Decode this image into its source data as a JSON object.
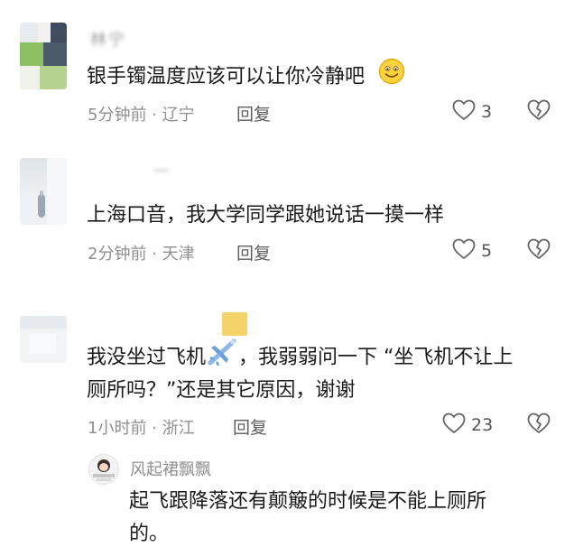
{
  "comments": [
    {
      "username": "林宁",
      "text": "银手镯温度应该可以让你冷静吧",
      "time": "5分钟前",
      "location": "辽宁",
      "reply_label": "回复",
      "likes": "3"
    },
    {
      "username": "—",
      "text": "上海口音，我大学同学跟她说话一摸一样",
      "time": "2分钟前",
      "location": "天津",
      "reply_label": "回复",
      "likes": "5"
    },
    {
      "username": "",
      "text_line1_a": "我没坐过飞机",
      "text_line1_b": "，我弱弱问一下 “坐飞机不让上",
      "text_line2": "厕所吗？”还是其它原因，谢谢",
      "time": "1小时前",
      "location": "浙江",
      "reply_label": "回复",
      "likes": "23"
    }
  ],
  "reply": {
    "username": "风起裙飘飘",
    "text_line1": "起飞跟降落还有颠簸的时候是不能上厕所",
    "text_line2": "的。"
  },
  "meta_separator": "·",
  "icons": {
    "like": "heart-outline-icon",
    "dislike": "broken-heart-icon",
    "emoji_smile": "smiling-face-emoji-icon",
    "emoji_plane": "airplane-emoji-icon"
  },
  "colors": {
    "text": "#1a1a1a",
    "meta": "#8f8f8f",
    "icon": "#666666"
  }
}
